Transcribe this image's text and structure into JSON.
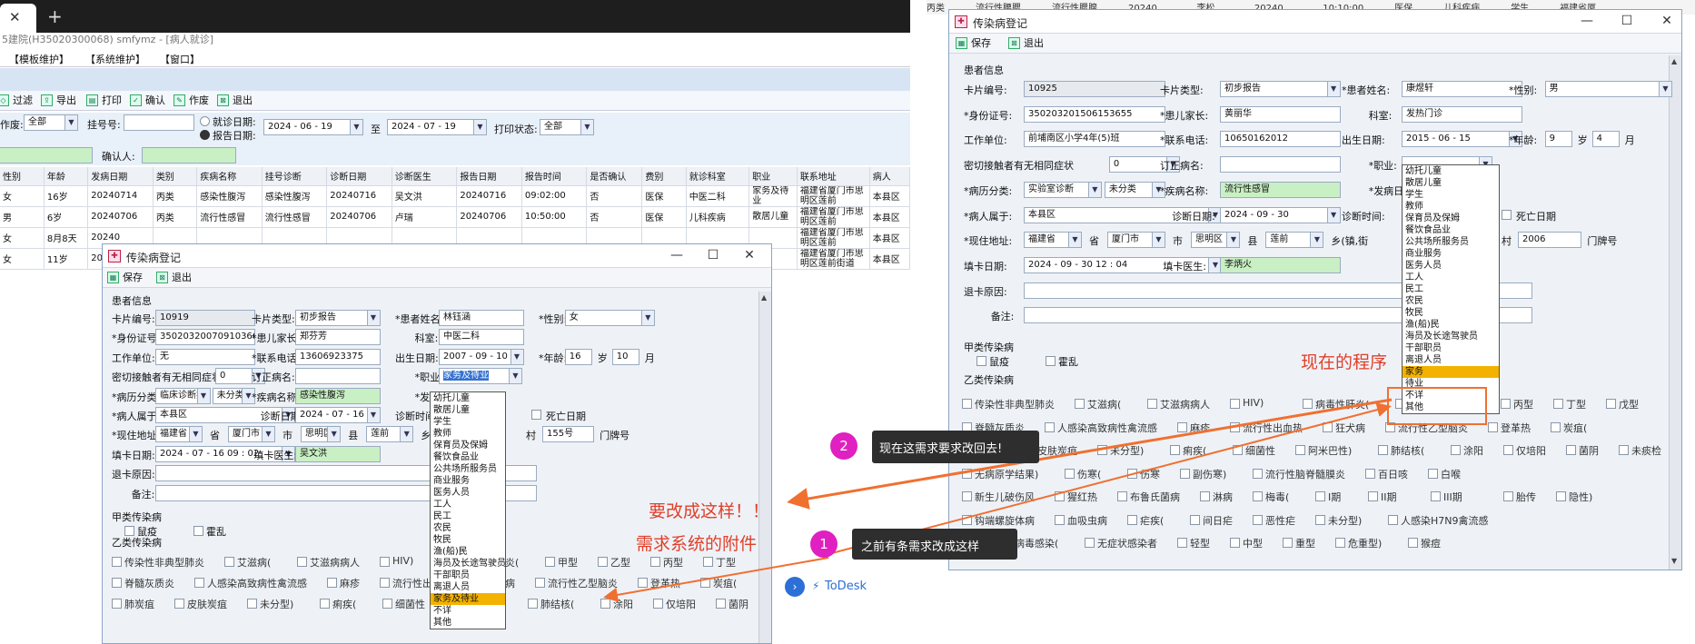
{
  "bg_app": {
    "tab_close": "✕",
    "tab_add": "+",
    "title": "5建院(H35020300068) smfymz - [病人就诊]",
    "menu": [
      "【模板维护】",
      "【系统维护】",
      "【窗口】"
    ],
    "toolbar": [
      "过滤",
      "导出",
      "打印",
      "确认",
      "作废",
      "退出"
    ],
    "filter": {
      "label1": "作废:",
      "val1": "全部",
      "label2": "挂号号:",
      "radio1": "就诊日期:",
      "radio2": "报告日期:",
      "date_from": "2024 - 06 - 19",
      "to": "至",
      "date_to": "2024 - 07 - 19",
      "print_label": "打印状态:",
      "print_val": "全部",
      "confirm_label": "确认人:"
    },
    "table_headers": [
      "性别",
      "年龄",
      "发病日期",
      "类别",
      "疾病名称",
      "挂号诊断",
      "诊断日期",
      "诊断医生",
      "报告日期",
      "报告时间",
      "是否确认",
      "费别",
      "就诊科室",
      "职业",
      "联系地址",
      "病人"
    ],
    "rows": [
      [
        "女",
        "16岁",
        "20240714",
        "丙类",
        "感染性腹泻",
        "感染性腹泻",
        "20240716",
        "吴文洪",
        "20240716",
        "09:02:00",
        "否",
        "医保",
        "中医二科",
        "家务及待业",
        "福建省厦门市思明区莲前",
        "本县区"
      ],
      [
        "男",
        "6岁",
        "20240706",
        "丙类",
        "流行性感冒",
        "流行性感冒",
        "20240706",
        "卢瑞",
        "20240706",
        "10:50:00",
        "否",
        "医保",
        "儿科疾病",
        "散居儿童",
        "福建省厦门市思明区莲前",
        "本县区"
      ],
      [
        "女",
        "8月8天",
        "20240",
        "",
        "",
        "",
        "",
        "",
        "",
        "",
        "",
        "",
        "",
        "",
        "福建省厦门市思明区莲前",
        "本县区"
      ],
      [
        "女",
        "11岁",
        "2024",
        "",
        "",
        "",
        "",
        "",
        "",
        "",
        "",
        "",
        "",
        "",
        "福建省厦门市思明区莲前街道",
        "本县区"
      ]
    ]
  },
  "form_labels": {
    "patient_info": "患者信息",
    "card_no": "卡片编号:",
    "card_type": "卡片类型:",
    "patient_name": "*患者姓名:",
    "gender": "*性别:",
    "id_no": "*身份证号:",
    "guardian": "*患儿家长:",
    "dept": "科室:",
    "work": "工作单位:",
    "phone": "*联系电话:",
    "birth": "出生日期:",
    "age": "*年龄:",
    "sui": "岁",
    "yue": "月",
    "contact": "密切接触者有无相同症状",
    "revised": "订正病名:",
    "occupation": "*职业:",
    "case_type": "*病历分类:",
    "disease": "*疾病名称:",
    "onset": "*发病日期:",
    "belong": "*病人属于:",
    "diag_date": "诊断日期:",
    "diag_time": "诊断时间:",
    "death": "死亡日期",
    "address": "*现住地址:",
    "sheng": "省",
    "shi": "市",
    "xian": "县",
    "xiang": "乡(镇,街",
    "cun": "村",
    "menpai": "门牌号",
    "fill_date": "填卡日期:",
    "fill_doctor": "填卡医生:",
    "return_reason": "退卡原因:",
    "remark": "备注:",
    "class_a": "甲类传染病",
    "plague": "鼠疫",
    "cholera": "霍乱",
    "class_b": "乙类传染病",
    "toolbar_save": "保存",
    "toolbar_exit": "退出",
    "win_title": "传染病登记"
  },
  "form1": {
    "card_no": "10919",
    "card_type": "初步报告",
    "patient_name": "林钰涵",
    "gender": "女",
    "id_no": "350203200709103661",
    "guardian": "郑芬芳",
    "dept": "中医二科",
    "work": "无",
    "phone": "13606923375",
    "birth": "2007 - 09 - 10",
    "age_y": "16",
    "age_m": "10",
    "contact": "0",
    "occupation": "家务及待业",
    "case_type": "临床诊断病例",
    "case_sub": "未分类",
    "disease": "感染性腹泻",
    "belong": "本县区",
    "diag_date": "2024 - 07 - 16",
    "prov": "福建省",
    "city": "厦门市",
    "county": "思明区",
    "town": "莲前",
    "village": "155号",
    "fill_date": "2024 - 07 - 16   09 : 02",
    "fill_doctor": "吴文洪",
    "diseases_row1": [
      "传染性非典型肺炎",
      "艾滋病(",
      "艾滋病病人",
      "HIV)",
      "病毒性肝炎(",
      "甲型",
      "乙型",
      "丙型",
      "丁型",
      "戊型",
      "未分型"
    ],
    "diseases_row2": [
      "脊髓灰质炎",
      "人感染高致病性禽流感",
      "麻疹",
      "流行性出血热",
      "狂犬病",
      "流行性乙型脑炎",
      "登革热",
      "炭疽("
    ],
    "diseases_row3": [
      "肺炭疽",
      "皮肤炭疽",
      "未分型)",
      "痢疾(",
      "细菌性",
      "阿米巴性)",
      "肺结核(",
      "涂阳",
      "仅培阳",
      "菌阴",
      "未痰检",
      "利福平耐药",
      "病原学阳性"
    ]
  },
  "occupations1": [
    "幼托儿童",
    "散居儿童",
    "学生",
    "教师",
    "保育员及保姆",
    "餐饮食品业",
    "公共场所服务员",
    "商业服务",
    "医务人员",
    "工人",
    "民工",
    "农民",
    "牧民",
    "渔(船)民",
    "海员及长途驾驶员",
    "干部职员",
    "离退人员",
    "家务及待业",
    "不详",
    "其他"
  ],
  "form2": {
    "card_no": "10925",
    "card_type": "初步报告",
    "patient_name": "康煜轩",
    "gender": "男",
    "id_no": "350203201506153655",
    "guardian": "黄丽华",
    "dept": "发热门诊",
    "work": "前埔南区小学4年(5)班",
    "phone": "10650162012",
    "birth": "2015 - 06 - 15",
    "age_y": "9",
    "age_m": "4",
    "contact": "0",
    "occupation": "",
    "case_type": "实验室诊断",
    "case_sub": "未分类",
    "disease": "流行性感冒",
    "belong": "本县区",
    "diag_date": "2024 - 09 - 30",
    "prov": "福建省",
    "city": "厦门市",
    "county": "思明区",
    "town": "莲前",
    "village": "2006",
    "fill_date": "2024 - 09 - 30   12 : 04",
    "fill_doctor": "李炳火",
    "diseases_rows": [
      [
        "传染性非典型肺炎",
        "艾滋病(",
        "艾滋病病人",
        "HIV)",
        "病毒性肝炎(",
        "甲型",
        "乙型",
        "丙型",
        "丁型",
        "戊型",
        "未分型)"
      ],
      [
        "脊髓灰质炎",
        "人感染高致病性禽流感",
        "麻疹",
        "流行性出血热",
        "狂犬病",
        "流行性乙型脑炎",
        "登革热",
        "炭疽("
      ],
      [
        "肺炭疽",
        "皮肤炭疽",
        "未分型)",
        "痢疾(",
        "细菌性",
        "阿米巴性)",
        "肺结核(",
        "涂阳",
        "仅培阳",
        "菌阴",
        "未痰检",
        "利福平耐药",
        "病原学阳性"
      ],
      [
        "无病原学结果)",
        "伤寒(",
        "伤寒",
        "副伤寒)",
        "流行性脑脊髓膜炎",
        "百日咳",
        "白喉"
      ],
      [
        "新生儿破伤风",
        "猩红热",
        "布鲁氏菌病",
        "淋病",
        "梅毒(",
        "I期",
        "II期",
        "III期",
        "胎传",
        "隐性)"
      ],
      [
        "钩端螺旋体病",
        "血吸虫病",
        "疟疾(",
        "间日疟",
        "恶性疟",
        "未分型)",
        "人感染H7N9禽流感"
      ],
      [
        "新型冠状病毒感染(",
        "无症状感染者",
        "轻型",
        "中型",
        "重型",
        "危重型)",
        "猴痘"
      ]
    ]
  },
  "occupations2": [
    "幼托儿童",
    "散居儿童",
    "学生",
    "教师",
    "保育员及保姆",
    "餐饮食品业",
    "公共场所服务员",
    "商业服务",
    "医务人员",
    "工人",
    "民工",
    "农民",
    "牧民",
    "渔(船)民",
    "海员及长途驾驶员",
    "干部职员",
    "离退人员",
    "家务",
    "待业",
    "不详",
    "其他"
  ],
  "top_right_table": [
    "丙类",
    "流行性腰腮",
    "流行性腮腺",
    "20240...",
    "李松...",
    "20240...",
    "10:10:00",
    "医保",
    "儿科疾病",
    "学生",
    "福建省厦"
  ],
  "annotations": {
    "change_like_this": "要改成这样！！",
    "attachment": "需求系统的附件",
    "current_program": "现在的程序",
    "badge1": "1",
    "callout1": "之前有条需求改成这样",
    "badge2": "2",
    "callout2": "现在这需求要求改回去!",
    "todesk": "ToDesk"
  },
  "colors": {
    "annotation_red": "#e0402a",
    "arrow_orange": "#f07030",
    "badge_magenta": "#e020c0",
    "highlight_yellow": "#f3b200"
  }
}
